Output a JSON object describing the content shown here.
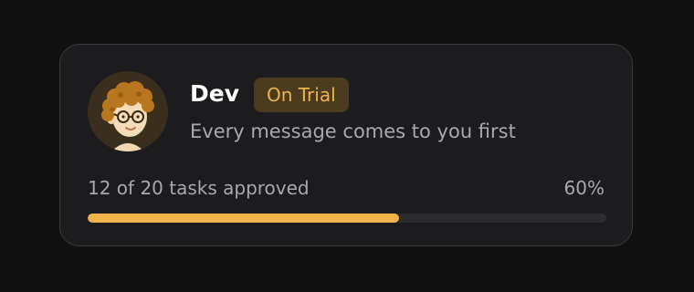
{
  "agent": {
    "name": "Dev",
    "badge": "On Trial",
    "description": "Every message comes to you first",
    "avatar_icon": "curly-haired-person-with-glasses"
  },
  "progress": {
    "label": "12 of 20 tasks approved",
    "percent_label": "60%",
    "completed": 12,
    "total": 20,
    "fraction": 0.6
  },
  "colors": {
    "accent": "#f0b24a",
    "badge_bg": "#4a3a1e",
    "card_bg": "#1c1c1e",
    "track": "#2c2c2e",
    "page_bg": "#111111"
  }
}
